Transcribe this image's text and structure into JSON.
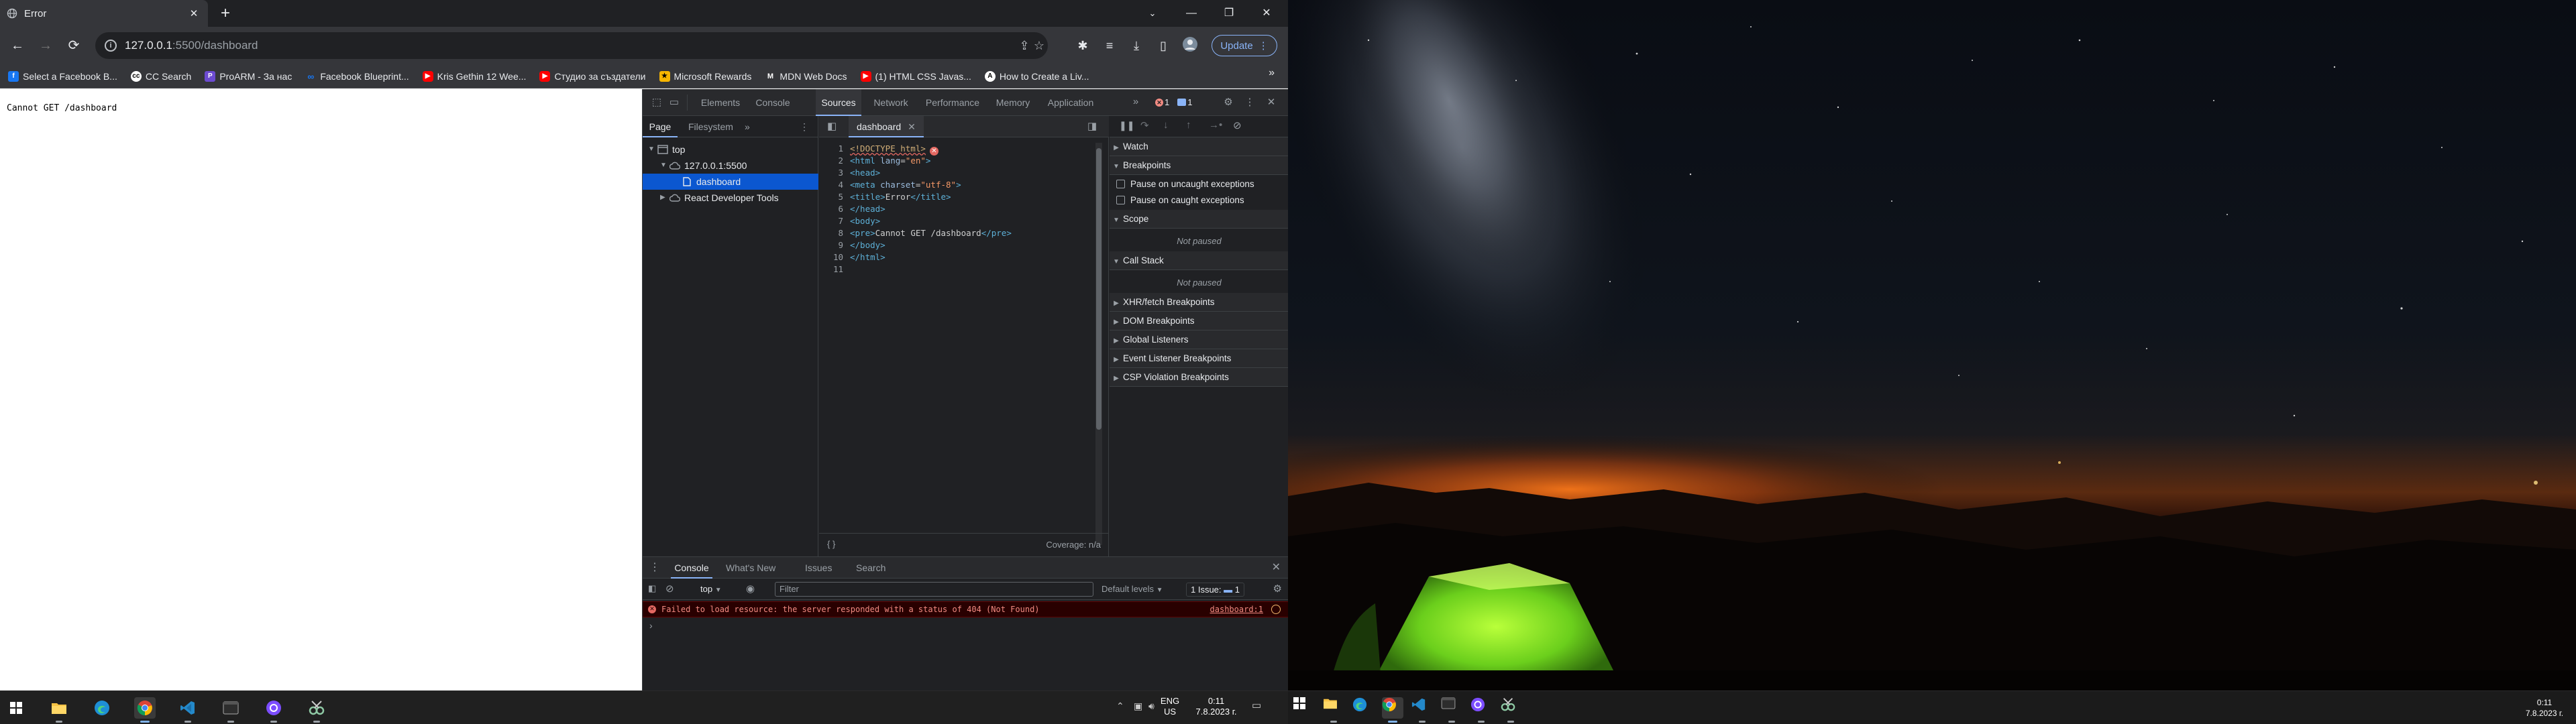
{
  "browser": {
    "tab_title": "Error",
    "url_host": "127.0.0.1",
    "url_path": ":5500/dashboard",
    "update_label": "Update",
    "bookmarks": [
      {
        "label": "Select a Facebook B...",
        "icon": "facebook-icon",
        "color": "#1877f2"
      },
      {
        "label": "CC Search",
        "icon": "cc-icon",
        "color": "#ffffff"
      },
      {
        "label": "ProARM - За нас",
        "icon": "proarm-icon",
        "color": "#6c4bd1"
      },
      {
        "label": "Facebook Blueprint...",
        "icon": "meta-icon",
        "color": "#1877f2"
      },
      {
        "label": "Kris Gethin 12 Wee...",
        "icon": "youtube-icon",
        "color": "#ff0000"
      },
      {
        "label": "Студио за създатели",
        "icon": "youtube-studio-icon",
        "color": "#ff0000"
      },
      {
        "label": "Microsoft Rewards",
        "icon": "rewards-icon",
        "color": "#f7b500"
      },
      {
        "label": "MDN Web Docs",
        "icon": "mdn-icon",
        "color": "#ffffff"
      },
      {
        "label": "(1) HTML CSS Javas...",
        "icon": "youtube-icon",
        "color": "#ff0000"
      },
      {
        "label": "How to Create a Liv...",
        "icon": "brand-icon",
        "color": "#ffffff"
      }
    ]
  },
  "page": {
    "body_text": "Cannot GET /dashboard"
  },
  "devtools": {
    "tabs": [
      "Elements",
      "Console",
      "Sources",
      "Network",
      "Performance",
      "Memory",
      "Application"
    ],
    "active_tab": "Sources",
    "error_count": "1",
    "issue_count": "1",
    "navigator": {
      "tabs": [
        "Page",
        "Filesystem"
      ],
      "tree": {
        "top": "top",
        "origin": "127.0.0.1:5500",
        "file": "dashboard",
        "extension": "React Developer Tools"
      }
    },
    "editor": {
      "file_tab": "dashboard",
      "coverage": "Coverage: n/a",
      "line_numbers": [
        "1",
        "2",
        "3",
        "4",
        "5",
        "6",
        "7",
        "8",
        "9",
        "10",
        "11"
      ],
      "lines": {
        "l1": "<!DOCTYPE html>",
        "l2a": "<html ",
        "l2b": "lang",
        "l2c": "=",
        "l2d": "\"en\"",
        "l2e": ">",
        "l3": "<head>",
        "l4a": "<meta ",
        "l4b": "charset",
        "l4c": "=",
        "l4d": "\"utf-8\"",
        "l4e": ">",
        "l5a": "<title>",
        "l5b": "Error",
        "l5c": "</title>",
        "l6": "</head>",
        "l7": "<body>",
        "l8a": "<pre>",
        "l8b": "Cannot GET /dashboard",
        "l8c": "</pre>",
        "l9": "</body>",
        "l10": "</html>"
      }
    },
    "debugger": {
      "watch": "Watch",
      "breakpoints": "Breakpoints",
      "pause_uncaught": "Pause on uncaught exceptions",
      "pause_caught": "Pause on caught exceptions",
      "scope": "Scope",
      "not_paused": "Not paused",
      "call_stack": "Call Stack",
      "xhr": "XHR/fetch Breakpoints",
      "dom": "DOM Breakpoints",
      "global": "Global Listeners",
      "event": "Event Listener Breakpoints",
      "csp": "CSP Violation Breakpoints"
    },
    "drawer": {
      "tabs": [
        "Console",
        "What's New",
        "Issues",
        "Search"
      ],
      "context": "top",
      "filter_placeholder": "Filter",
      "levels": "Default levels",
      "issues_badge": "1 Issue:",
      "issues_badge_count": "1",
      "error_message": "Failed to load resource: the server responded with a status of 404 (Not Found)",
      "error_source": "dashboard:1",
      "prompt": "›"
    }
  },
  "taskbar": {
    "language": "ENG",
    "region": "US",
    "time": "0:11",
    "date": "7.8.2023 г.",
    "time_right": "0:11",
    "date_right": "7.8.2023 г."
  }
}
